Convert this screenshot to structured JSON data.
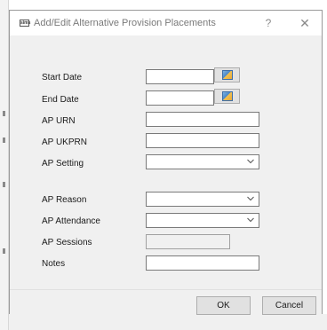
{
  "dialog": {
    "icon_text": "sims",
    "title": "Add/Edit Alternative Provision Placements",
    "help_label": "?",
    "close_label": "✕"
  },
  "form": {
    "start_date": {
      "label": "Start Date",
      "value": ""
    },
    "end_date": {
      "label": "End Date",
      "value": ""
    },
    "ap_urn": {
      "label": "AP URN",
      "value": ""
    },
    "ap_ukprn": {
      "label": "AP UKPRN",
      "value": ""
    },
    "ap_setting": {
      "label": "AP Setting",
      "value": ""
    },
    "ap_reason": {
      "label": "AP Reason",
      "value": ""
    },
    "ap_attendance": {
      "label": "AP Attendance",
      "value": ""
    },
    "ap_sessions": {
      "label": "AP Sessions",
      "value": ""
    },
    "notes": {
      "label": "Notes",
      "value": ""
    }
  },
  "buttons": {
    "ok": "OK",
    "cancel": "Cancel"
  },
  "icons": {
    "calendar": "calendar-icon",
    "dropdown": "chevron-down-icon",
    "app": "app-icon"
  }
}
